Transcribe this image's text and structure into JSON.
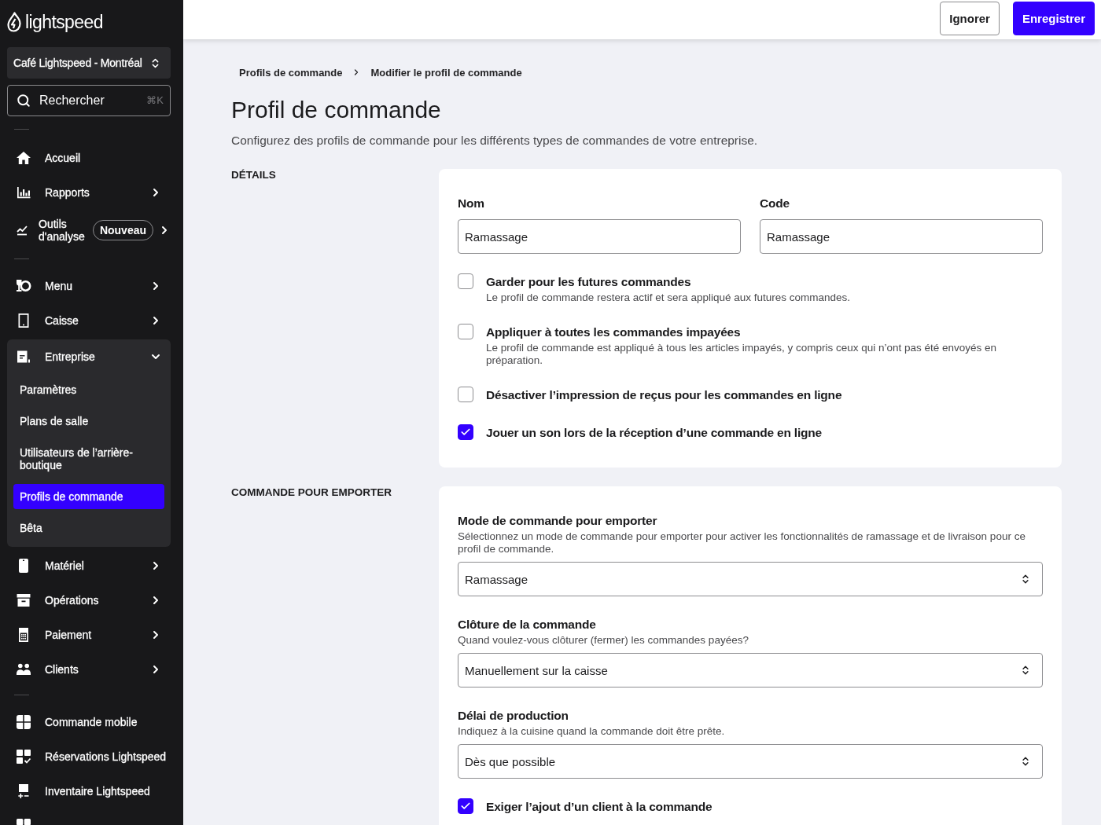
{
  "sidebar": {
    "logo": "lightspeed",
    "location": "Café Lightspeed - Montréal",
    "search": {
      "placeholder": "Rechercher",
      "shortcut": "⌘K"
    },
    "groups": [
      {
        "items": [
          {
            "label": "Accueil",
            "selected": false
          },
          {
            "label": "Rapports",
            "selected": false,
            "expanded": false
          },
          {
            "label": "Outils d'analyse",
            "badge": "Nouveau",
            "selected": false,
            "expanded": false
          }
        ]
      },
      {
        "items": [
          {
            "label": "Menu",
            "selected": false,
            "expanded": false
          },
          {
            "label": "Caisse",
            "selected": false,
            "expanded": false
          },
          {
            "label": "Entreprise",
            "selected": false,
            "expanded": true,
            "children": [
              {
                "label": "Paramètres",
                "selected": false
              },
              {
                "label": "Plans de salle",
                "selected": false
              },
              {
                "label": "Utilisateurs de l’arrière-boutique",
                "selected": false
              },
              {
                "label": "Profils de commande",
                "selected": true
              },
              {
                "label": "Bêta",
                "selected": false
              }
            ]
          },
          {
            "label": "Matériel",
            "selected": false,
            "expanded": false
          },
          {
            "label": "Opérations",
            "selected": false,
            "expanded": false
          },
          {
            "label": "Paiement",
            "selected": false,
            "expanded": false
          },
          {
            "label": "Clients",
            "selected": false,
            "expanded": false
          }
        ]
      },
      {
        "items": [
          {
            "label": "Commande mobile",
            "selected": false
          },
          {
            "label": "Réservations Lightspeed",
            "selected": false
          },
          {
            "label": "Inventaire Lightspeed",
            "selected": false
          },
          {
            "selected": false
          }
        ]
      }
    ]
  },
  "topbar": {
    "buttons": [
      {
        "label": "Ignorer",
        "kind": "secondary"
      },
      {
        "label": "Enregistrer",
        "kind": "primary"
      }
    ]
  },
  "breadcrumb": [
    {
      "label": "Profils de commande"
    },
    {
      "label": "Modifier le profil de commande"
    }
  ],
  "title": "Profil de commande",
  "description": "Configurez des profils de commande pour les différents types de commandes de votre entreprise.",
  "sections": [
    {
      "heading": "DÉTAILS",
      "fields": [
        {
          "label": "Nom",
          "value": "Ramassage"
        },
        {
          "label": "Code",
          "value": "Ramassage"
        }
      ],
      "options": [
        {
          "label": "Garder pour les futures commandes",
          "description": "Le profil de commande restera actif et sera appliqué aux futures commandes.",
          "checked": false
        },
        {
          "label": "Appliquer à toutes les commandes impayées",
          "description": "Le profil de commande est appliqué à tous les articles impayés, y compris ceux qui n’ont pas été envoyés en préparation.",
          "checked": false
        },
        {
          "label": "Désactiver l’impression de reçus pour les commandes en ligne",
          "checked": false
        },
        {
          "label": "Jouer un son lors de la réception d’une commande en ligne",
          "checked": true
        }
      ]
    },
    {
      "heading": "COMMANDE POUR EMPORTER",
      "selects": [
        {
          "label": "Mode de commande pour emporter",
          "description": "Sélectionnez un mode de commande pour emporter pour activer les fonctionnalités de ramassage et de livraison pour ce profil de commande.",
          "value": "Ramassage"
        },
        {
          "label": "Clôture de la commande",
          "description": "Quand voulez-vous clôturer (fermer) les commandes payées?",
          "value": "Manuellement sur la caisse"
        },
        {
          "label": "Délai de production",
          "description": "Indiquez à la cuisine quand la commande doit être prête.",
          "value": "Dès que possible"
        }
      ],
      "options": [
        {
          "label": "Exiger l’ajout d’un client à la commande",
          "checked": true
        }
      ]
    }
  ]
}
